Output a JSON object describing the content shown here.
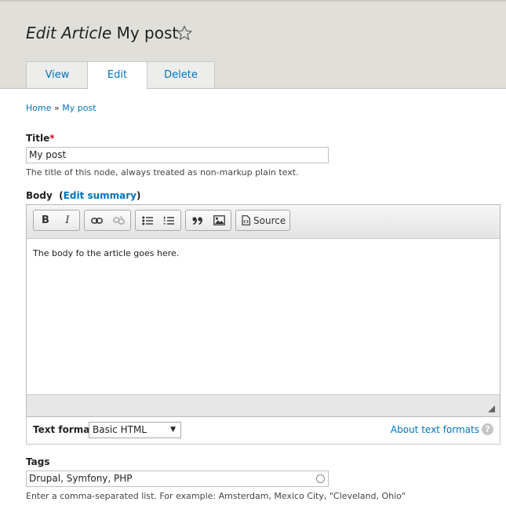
{
  "header": {
    "title_prefix": "Edit Article",
    "title_node": "My post",
    "tabs": [
      {
        "label": "View"
      },
      {
        "label": "Edit"
      },
      {
        "label": "Delete"
      }
    ]
  },
  "breadcrumb": {
    "home": "Home",
    "separator": "»",
    "current": "My post"
  },
  "title_field": {
    "label": "Title",
    "required_mark": "*",
    "value": "My post",
    "description": "The title of this node, always treated as non-markup plain text."
  },
  "body_field": {
    "label": "Body",
    "open_paren": "(",
    "summary_link": "Edit summary",
    "close_paren": ")",
    "toolbar": {
      "bold": "B",
      "italic": "I",
      "source_label": "Source"
    },
    "content": "The body fo the article goes here."
  },
  "text_format": {
    "label": "Text format",
    "selected": "Basic HTML",
    "about_link": "About text formats",
    "help_glyph": "?"
  },
  "tags_field": {
    "label": "Tags",
    "value": "Drupal, Symfony, PHP",
    "description": "Enter a comma-separated list. For example: Amsterdam, Mexico City, \"Cleveland, Ohio\""
  },
  "colors": {
    "link": "#0074bd",
    "header_bg": "#e0dfd9",
    "required": "#e0001a"
  }
}
